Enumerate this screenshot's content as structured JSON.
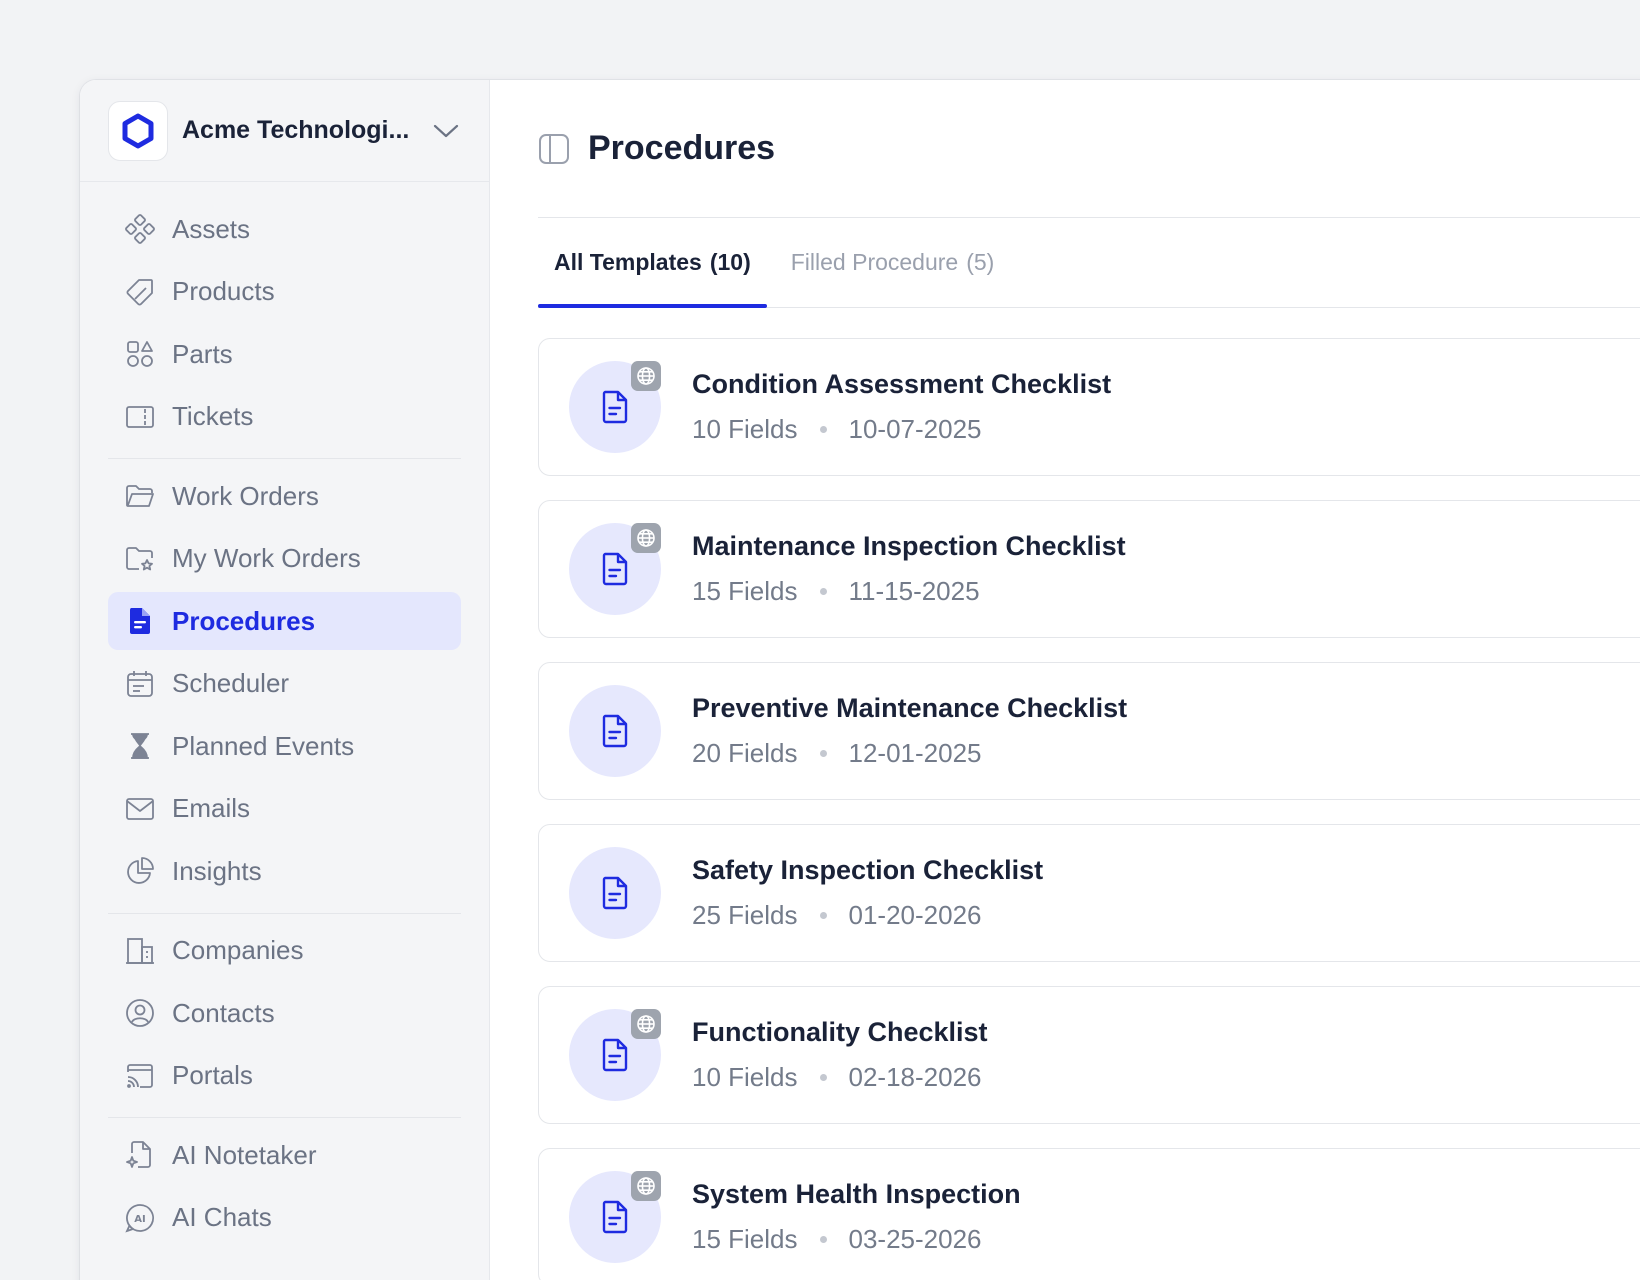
{
  "org": {
    "name": "Acme Technologi...",
    "logo_icon": "hexagon-logo-icon",
    "brand_color": "#1e2be0"
  },
  "sidebar": {
    "groups": [
      [
        {
          "label": "Assets",
          "icon": "assets-icon"
        },
        {
          "label": "Products",
          "icon": "tag-icon"
        },
        {
          "label": "Parts",
          "icon": "shapes-icon"
        },
        {
          "label": "Tickets",
          "icon": "ticket-icon"
        }
      ],
      [
        {
          "label": "Work Orders",
          "icon": "folder-icon"
        },
        {
          "label": "My Work Orders",
          "icon": "folder-star-icon"
        },
        {
          "label": "Procedures",
          "icon": "document-icon",
          "active": true
        },
        {
          "label": "Scheduler",
          "icon": "calendar-icon"
        },
        {
          "label": "Planned Events",
          "icon": "hourglass-icon"
        },
        {
          "label": "Emails",
          "icon": "mail-icon"
        },
        {
          "label": "Insights",
          "icon": "pie-chart-icon"
        }
      ],
      [
        {
          "label": "Companies",
          "icon": "building-icon"
        },
        {
          "label": "Contacts",
          "icon": "user-circle-icon"
        },
        {
          "label": "Portals",
          "icon": "portal-icon"
        }
      ],
      [
        {
          "label": "AI Notetaker",
          "icon": "ai-note-icon"
        },
        {
          "label": "AI Chats",
          "icon": "ai-chat-icon"
        }
      ]
    ]
  },
  "header": {
    "title": "Procedures"
  },
  "tabs": [
    {
      "label": "All Templates",
      "count": "(10)",
      "active": true
    },
    {
      "label": "Filled Procedure",
      "count": "(5)",
      "active": false
    }
  ],
  "procedures": [
    {
      "title": "Condition Assessment Checklist",
      "fields": "10 Fields",
      "date": "10-07-2025",
      "public": true
    },
    {
      "title": "Maintenance Inspection Checklist",
      "fields": "15 Fields",
      "date": "11-15-2025",
      "public": true
    },
    {
      "title": "Preventive Maintenance Checklist",
      "fields": "20 Fields",
      "date": "12-01-2025",
      "public": false
    },
    {
      "title": "Safety Inspection Checklist",
      "fields": "25 Fields",
      "date": "01-20-2026",
      "public": false
    },
    {
      "title": "Functionality Checklist",
      "fields": "10 Fields",
      "date": "02-18-2026",
      "public": true
    },
    {
      "title": "System Health Inspection",
      "fields": "15 Fields",
      "date": "03-25-2026",
      "public": true
    }
  ]
}
